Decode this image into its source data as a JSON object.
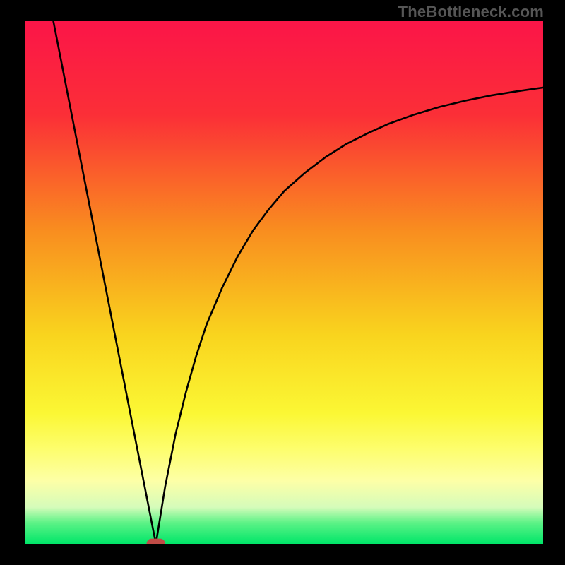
{
  "watermark": "TheBottleneck.com",
  "chart_data": {
    "type": "line",
    "title": "",
    "xlabel": "",
    "ylabel": "",
    "xlim": [
      0,
      100
    ],
    "ylim": [
      0,
      100
    ],
    "gradient_stops": [
      {
        "offset": 0,
        "color": "#fb1548"
      },
      {
        "offset": 18,
        "color": "#fb2f37"
      },
      {
        "offset": 40,
        "color": "#f98d1f"
      },
      {
        "offset": 60,
        "color": "#f9d41e"
      },
      {
        "offset": 75,
        "color": "#fbf734"
      },
      {
        "offset": 82,
        "color": "#fdfe6e"
      },
      {
        "offset": 88,
        "color": "#fdffa7"
      },
      {
        "offset": 93,
        "color": "#d5fcba"
      },
      {
        "offset": 96,
        "color": "#5cf286"
      },
      {
        "offset": 100,
        "color": "#00e669"
      }
    ],
    "series": [
      {
        "name": "left-leg",
        "type": "line",
        "x": [
          5.4,
          25.2
        ],
        "y": [
          100,
          0
        ]
      },
      {
        "name": "right-curve",
        "type": "line",
        "x": [
          25.2,
          27,
          29,
          31,
          33,
          35,
          38,
          41,
          44,
          47,
          50,
          54,
          58,
          62,
          66,
          70,
          75,
          80,
          85,
          90,
          95,
          100
        ],
        "y": [
          0,
          11,
          21,
          29,
          36,
          42,
          49,
          55,
          60,
          64,
          67.5,
          71,
          74,
          76.5,
          78.5,
          80.3,
          82.1,
          83.6,
          84.8,
          85.8,
          86.6,
          87.3
        ]
      }
    ],
    "marker": {
      "name": "min-marker",
      "x": 25.2,
      "y": 0,
      "shape": "stadium",
      "width_pct": 3.6,
      "height_pct": 2.0,
      "color": "#bf4b46"
    }
  }
}
